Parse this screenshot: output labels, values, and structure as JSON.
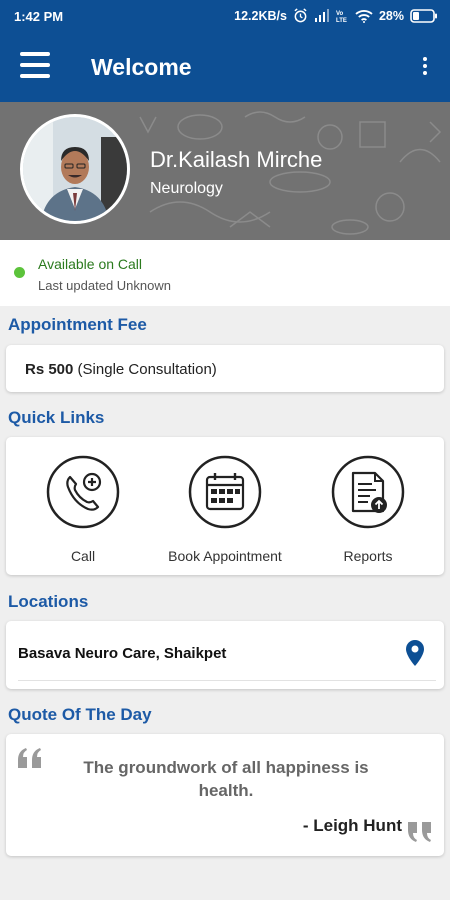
{
  "status_bar": {
    "time": "1:42 PM",
    "network_speed": "12.2KB/s",
    "battery": "28%"
  },
  "app_bar": {
    "title": "Welcome"
  },
  "profile": {
    "name": "Dr.Kailash Mirche",
    "department": "Neurology"
  },
  "availability": {
    "status": "Available on Call",
    "updated": "Last updated Unknown",
    "status_color": "#5cc33b"
  },
  "appointment_fee": {
    "section_title": "Appointment Fee",
    "amount": "Rs 500",
    "description": "(Single Consultation)"
  },
  "quick_links": {
    "section_title": "Quick Links",
    "items": [
      {
        "label": "Call",
        "icon": "phone-plus-icon"
      },
      {
        "label": "Book Appointment",
        "icon": "calendar-icon"
      },
      {
        "label": "Reports",
        "icon": "report-upload-icon"
      }
    ]
  },
  "locations": {
    "section_title": "Locations",
    "items": [
      {
        "name": "Basava Neuro Care, Shaikpet",
        "icon": "map-pin-icon"
      }
    ]
  },
  "quote": {
    "section_title": "Quote Of The Day",
    "text": "The groundwork of all happiness is health.",
    "author": "- Leigh Hunt"
  },
  "colors": {
    "primary": "#0d4f94",
    "section_title": "#1d5aa6",
    "background": "#efefef"
  }
}
